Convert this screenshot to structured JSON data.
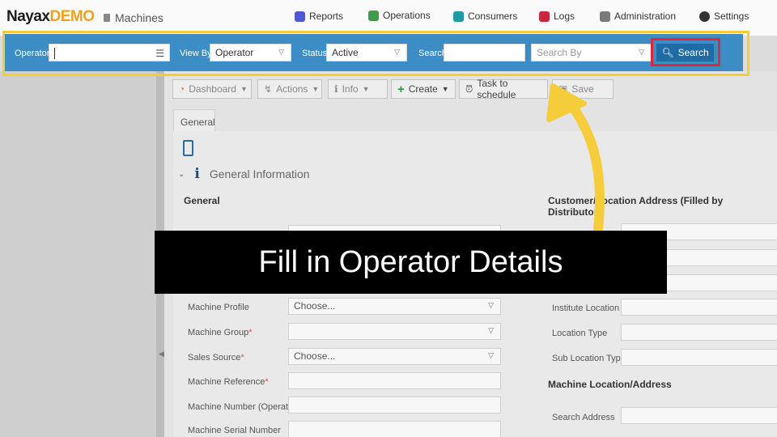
{
  "header": {
    "logo_main": "Nayax",
    "logo_demo": "DEMO",
    "section": "Machines",
    "nav": [
      {
        "label": "Reports",
        "icon": "reports-icon",
        "color": "#4c5bd4"
      },
      {
        "label": "Operations",
        "icon": "operations-icon",
        "color": "#3f9c4a"
      },
      {
        "label": "Consumers",
        "icon": "consumers-icon",
        "color": "#1f9aa3"
      },
      {
        "label": "Logs",
        "icon": "logs-icon",
        "color": "#c8283c"
      },
      {
        "label": "Administration",
        "icon": "administration-icon",
        "color": "#7a7a7a"
      },
      {
        "label": "Settings",
        "icon": "settings-icon",
        "color": "#333333"
      }
    ]
  },
  "search_bar": {
    "operator_label": "Operator",
    "operator_value": "",
    "view_by_label": "View By",
    "view_by_value": "Operator",
    "status_label": "Status",
    "status_value": "Active",
    "search_label": "Search",
    "search_value": "",
    "search_by_placeholder": "Search By",
    "search_button": "Search"
  },
  "actions": {
    "dashboard": "Dashboard",
    "actions": "Actions",
    "info": "Info",
    "create": "Create",
    "task_to_schedule": "Task to schedule",
    "save": "Save"
  },
  "tabs": {
    "general": "General"
  },
  "general_information": {
    "title": "General Information",
    "general_heading": "General",
    "right_heading": "Customer/Location Address (Filled by Distributor)",
    "machine_profile_label": "Machine Profile",
    "machine_profile_value": "Choose...",
    "machine_group_label": "Machine Group",
    "sales_source_label": "Sales Source",
    "sales_source_value": "Choose...",
    "machine_reference_label": "Machine Reference",
    "machine_number_label": "Machine Number (Operator)",
    "machine_serial_label": "Machine Serial Number",
    "required_mark": "*",
    "institute_location_label": "Institute Location",
    "location_type_label": "Location Type",
    "sub_location_type_label": "Sub Location Type",
    "machine_location_heading": "Machine Location/Address",
    "search_address_label": "Search Address"
  },
  "overlay": {
    "banner_text": "Fill in Operator Details",
    "highlight_color": "#f5cc3a",
    "button_outline_color": "#e0283a"
  }
}
